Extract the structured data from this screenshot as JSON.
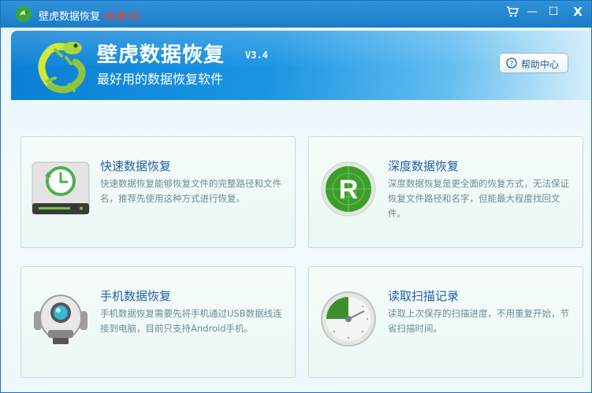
{
  "window": {
    "title": "壁虎数据恢复",
    "status": "(未激活)",
    "controls": {
      "cart": "🛒",
      "minimize": "—",
      "maximize": "☐",
      "close": "X"
    }
  },
  "banner": {
    "app_name": "壁虎数据恢复",
    "version": "V3.4",
    "slogan": "最好用的数据恢复软件",
    "help_label": "帮助中心"
  },
  "features": [
    {
      "title": "快速数据恢复",
      "description": "快速数据恢复能够恢复文件的完整路径和文件名，推荐先使用这种方式进行恢复。",
      "icon": "clock-drive-icon"
    },
    {
      "title": "深度数据恢复",
      "description": "深度数据恢复是更全面的恢复方式，无法保证恢复文件路径和名字，但能最大程度找回文件。",
      "icon": "radar-r-icon"
    },
    {
      "title": "手机数据恢复",
      "description": "手机数据恢复需要先将手机通过USB数据线连接到电脑，目前只支持Android手机。",
      "icon": "robot-icon"
    },
    {
      "title": "读取扫描记录",
      "description": "读取上次保存的扫描进度，不用重复开始，节省扫描时间。",
      "icon": "progress-dial-icon"
    }
  ],
  "colors": {
    "title_bar": "#1a7cc9",
    "banner": "#1b95e3",
    "card_title": "#1f5fb0",
    "status_red": "#ff3c1e",
    "accent_green": "#3d9d2b"
  }
}
